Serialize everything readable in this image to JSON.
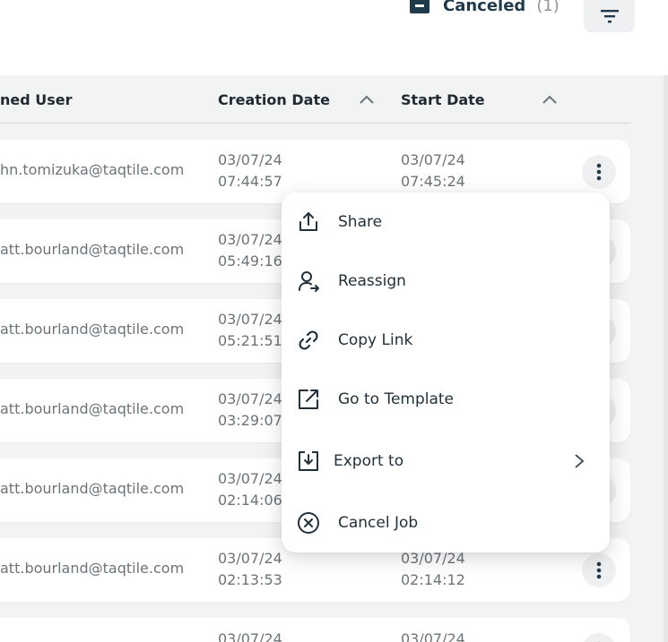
{
  "filter": {
    "label": "Canceled",
    "count": "(1)"
  },
  "table": {
    "headers": {
      "assigned_user": "ned User",
      "creation_date": "Creation Date",
      "start_date": "Start Date"
    },
    "rows": [
      {
        "user": "hn.tomizuka@taqtile.com",
        "creation_date": "03/07/24",
        "creation_time": "07:44:57",
        "start_date": "03/07/24",
        "start_time": "07:45:24"
      },
      {
        "user": "att.bourland@taqtile.com",
        "creation_date": "03/07/24",
        "creation_time": "05:49:16",
        "start_date": "",
        "start_time": ""
      },
      {
        "user": "att.bourland@taqtile.com",
        "creation_date": "03/07/24",
        "creation_time": "05:21:51",
        "start_date": "",
        "start_time": ""
      },
      {
        "user": "att.bourland@taqtile.com",
        "creation_date": "03/07/24",
        "creation_time": "03:29:07",
        "start_date": "",
        "start_time": ""
      },
      {
        "user": "att.bourland@taqtile.com",
        "creation_date": "03/07/24",
        "creation_time": "02:14:06",
        "start_date": "",
        "start_time": ""
      },
      {
        "user": "att.bourland@taqtile.com",
        "creation_date": "03/07/24",
        "creation_time": "02:13:53",
        "start_date": "03/07/24",
        "start_time": "02:14:12"
      },
      {
        "user": "",
        "creation_date": "03/07/24",
        "creation_time": "",
        "start_date": "03/07/24",
        "start_time": ""
      }
    ]
  },
  "menu": {
    "items": [
      {
        "label": "Share",
        "icon": "share-icon"
      },
      {
        "label": "Reassign",
        "icon": "reassign-icon"
      },
      {
        "label": "Copy Link",
        "icon": "link-icon"
      },
      {
        "label": "Go to Template",
        "icon": "open-external-icon"
      },
      {
        "label": "Export to",
        "icon": "export-icon"
      },
      {
        "label": "Cancel Job",
        "icon": "cancel-circle-icon"
      }
    ]
  },
  "colors": {
    "accent": "#1f3a4d",
    "muted_text": "#6b7479",
    "table_bg": "#f2f3f3"
  }
}
